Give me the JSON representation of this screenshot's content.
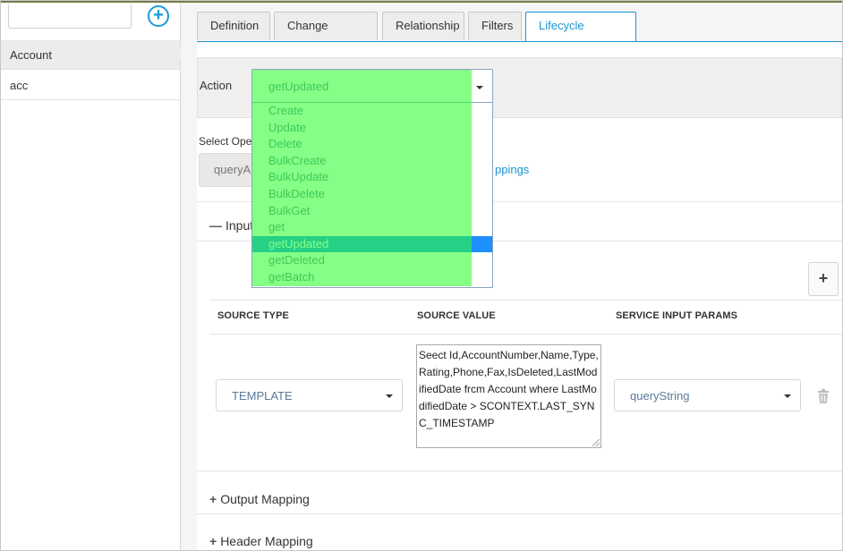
{
  "sidebar": {
    "items": [
      {
        "label": "Account",
        "active": true
      },
      {
        "label": "acc",
        "active": false
      }
    ]
  },
  "tabs": [
    {
      "label": "Definition",
      "active": false
    },
    {
      "label": "Change Tracking",
      "active": false
    },
    {
      "label": "Relationship",
      "active": false
    },
    {
      "label": "Filters",
      "active": false
    },
    {
      "label": "Lifecycle Methods",
      "active": true
    }
  ],
  "action": {
    "label": "Action",
    "selected": "getUpdated",
    "options": [
      "Create",
      "Update",
      "Delete",
      "BulkCreate",
      "BulkUpdate",
      "BulkDelete",
      "BulkGet",
      "get",
      "getUpdated",
      "getDeleted",
      "getBatch"
    ]
  },
  "operation": {
    "label": "Select Oper",
    "value": "queryAl",
    "link": "ppings"
  },
  "sections": {
    "input": "Input",
    "output": "Output Mapping",
    "header": "Header Mapping"
  },
  "table": {
    "headers": [
      "SOURCE TYPE",
      "SOURCE VALUE",
      "SERVICE INPUT PARAMS"
    ],
    "row": {
      "source_type": "TEMPLATE",
      "source_value": "Seect Id,AccountNumber,Name,Type,Rating,Phone,Fax,IsDeleted,LastModifiedDate frcm Account where LastModifiedDate > SCONTEXT.LAST_SYNC_TIMESTAMP",
      "service_param": "queryString"
    }
  },
  "colors": {
    "accent": "#1b95d2",
    "highlight_overlay": "#2dff2d",
    "selected_option": "#1e90ff"
  },
  "icons": [
    "add-circle-icon",
    "chevron-down-icon",
    "minus-icon",
    "plus-icon",
    "trash-icon"
  ]
}
